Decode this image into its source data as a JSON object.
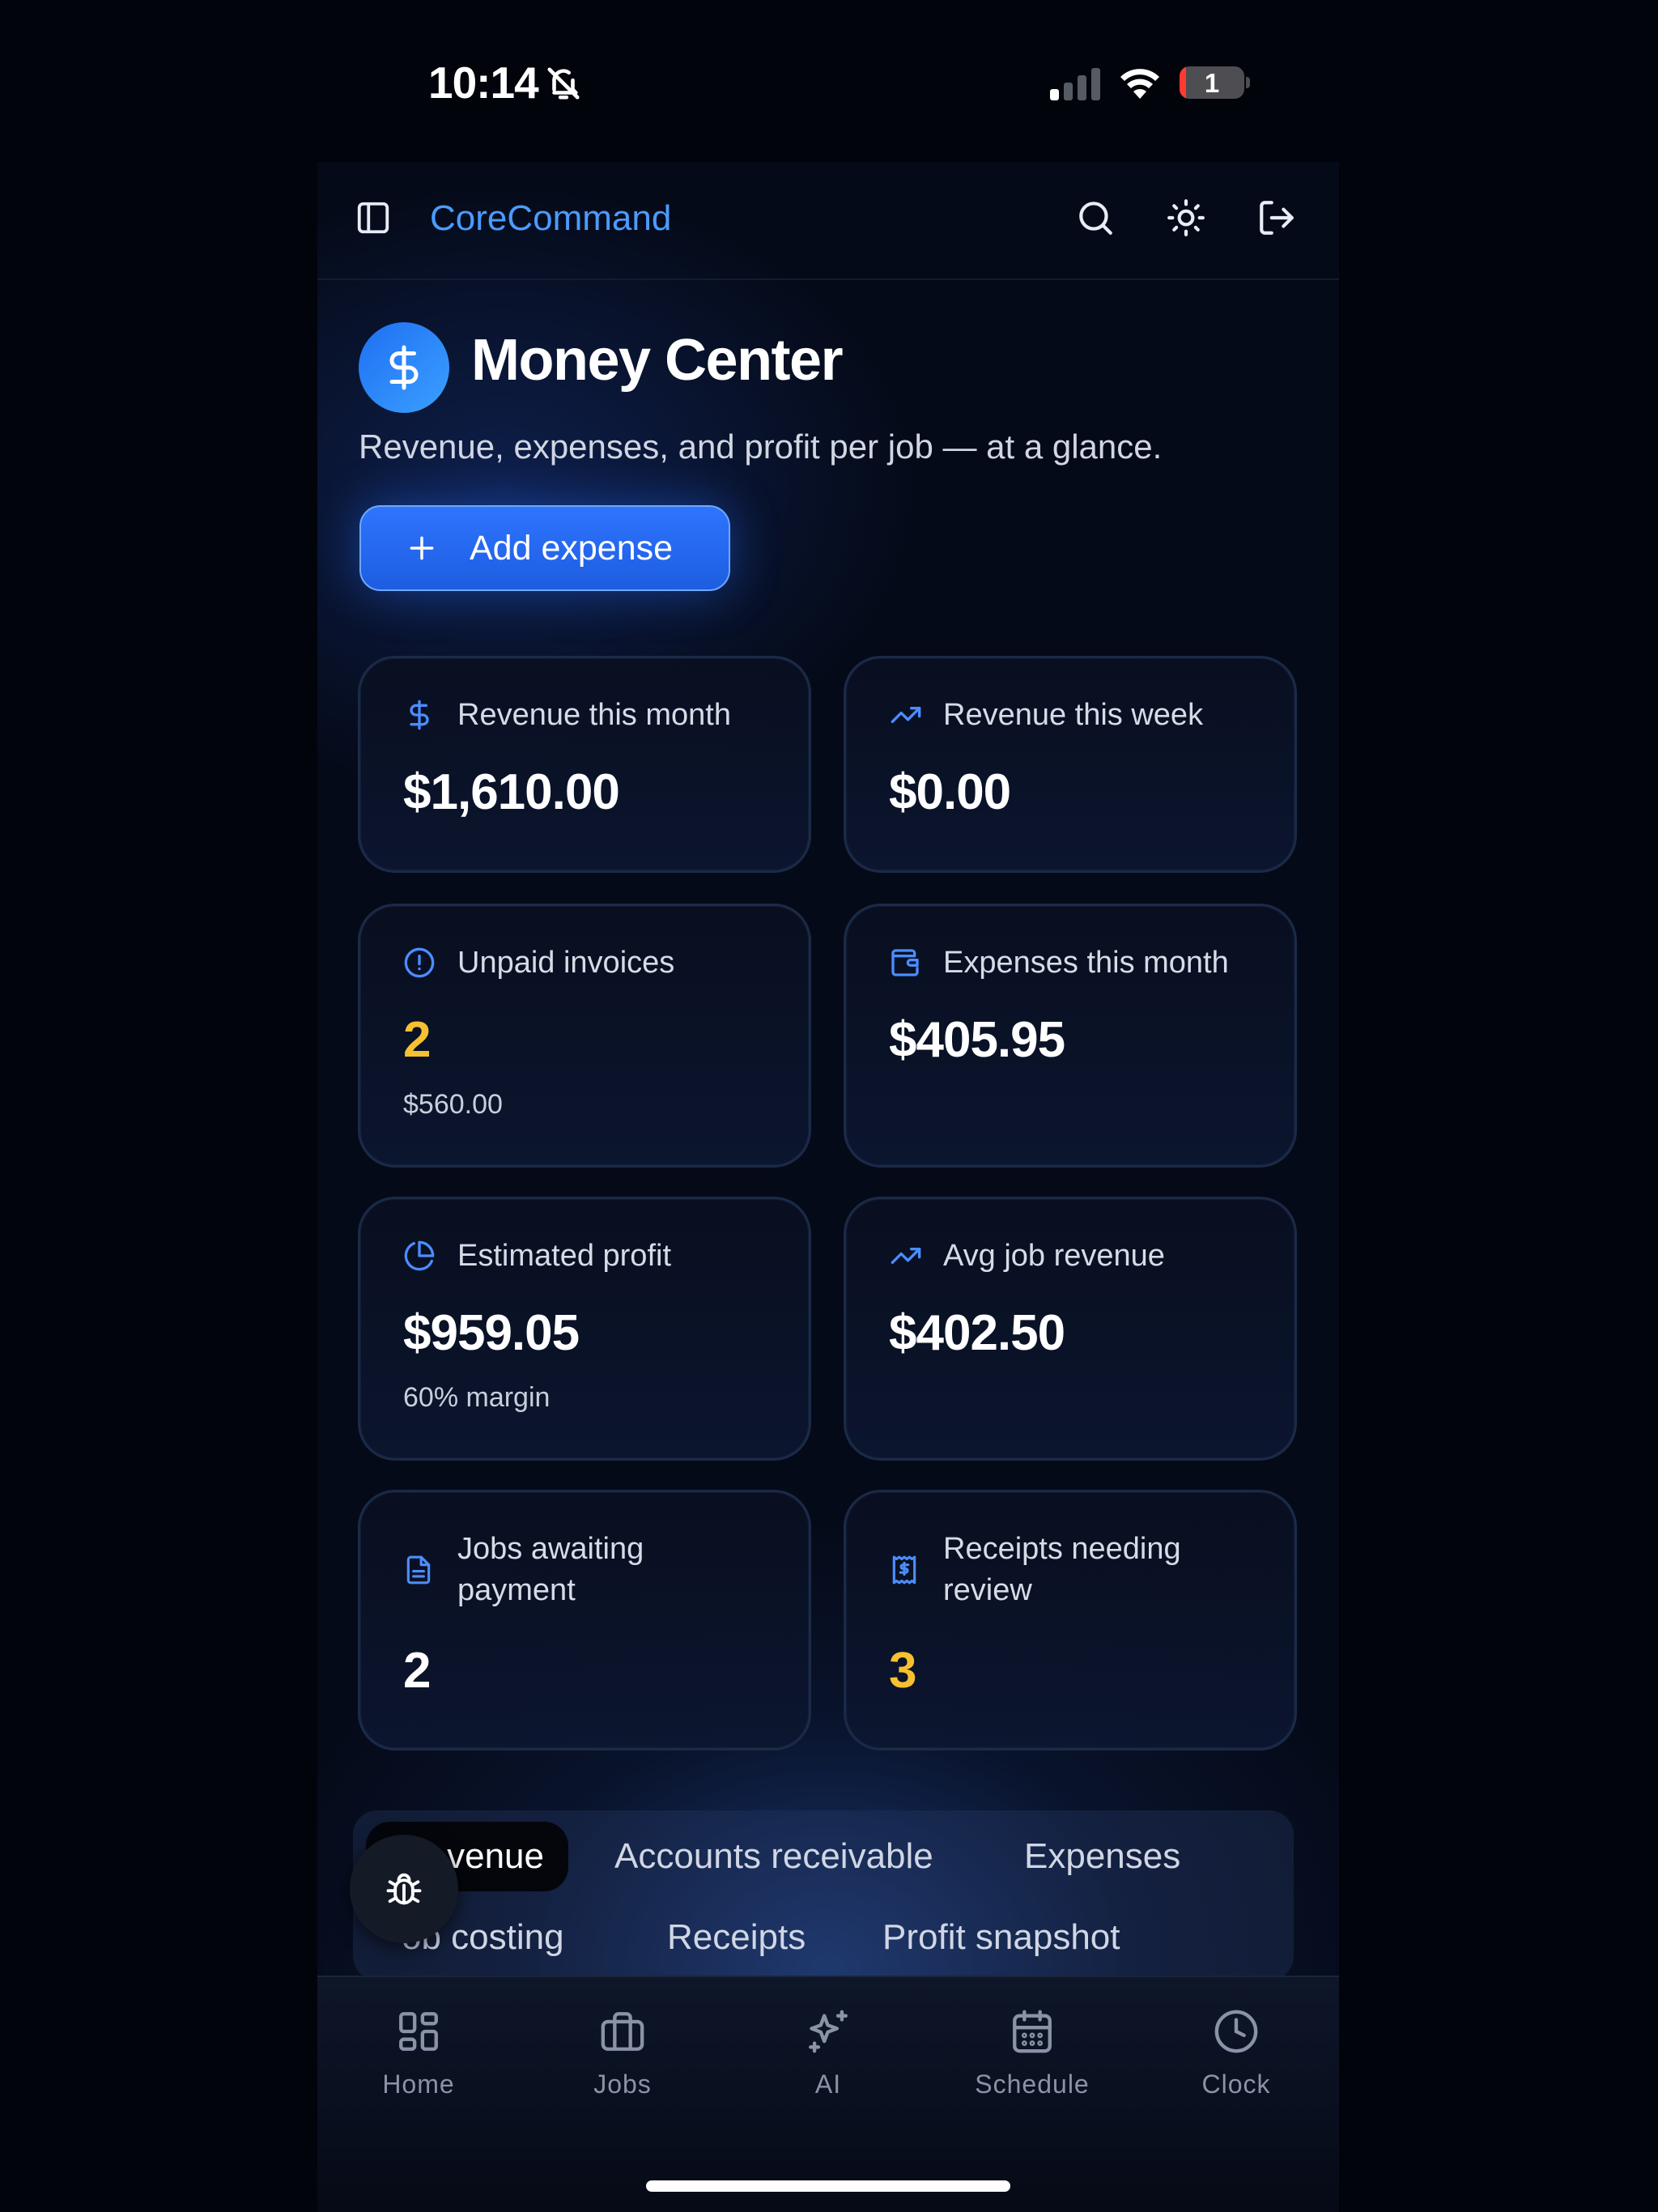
{
  "status_bar": {
    "time": "10:14",
    "battery_level": "1"
  },
  "header": {
    "brand": "CoreCommand"
  },
  "page": {
    "title": "Money Center",
    "subtitle": "Revenue, expenses, and profit per job — at a glance.",
    "add_expense_label": "Add expense"
  },
  "cards": [
    {
      "label": "Revenue this month",
      "value": "$1,610.00",
      "icon": "dollar-icon"
    },
    {
      "label": "Revenue this week",
      "value": "$0.00",
      "icon": "trending-up-icon"
    },
    {
      "label": "Unpaid invoices",
      "value": "2",
      "sub": "$560.00",
      "icon": "alert-circle-icon"
    },
    {
      "label": "Expenses this month",
      "value": "$405.95",
      "icon": "wallet-icon"
    },
    {
      "label": "Estimated profit",
      "value": "$959.05",
      "sub": "60% margin",
      "icon": "pie-chart-icon"
    },
    {
      "label": "Avg job revenue",
      "value": "$402.50",
      "icon": "trending-up-icon"
    },
    {
      "label_line1": "Jobs awaiting",
      "label_line2": "payment",
      "value": "2",
      "icon": "document-icon"
    },
    {
      "label_line1": "Receipts needing",
      "label_line2": "review",
      "value": "3",
      "icon": "receipt-icon"
    }
  ],
  "tabs": {
    "row1": [
      "venue",
      "Accounts receivable",
      "Expenses"
    ],
    "row2": [
      "Job costing",
      "Receipts",
      "Profit snapshot"
    ],
    "row2_visible_first": "ob costing"
  },
  "bottom_nav": [
    "Home",
    "Jobs",
    "AI",
    "Schedule",
    "Clock"
  ],
  "colors": {
    "accent": "#4b9bff",
    "warning": "#f6c131",
    "background": "#050a18"
  }
}
